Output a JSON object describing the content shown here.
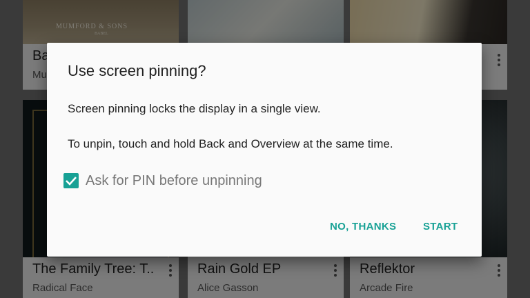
{
  "background": {
    "top_cards": [
      {
        "title": "Ba",
        "subtitle": "Mu",
        "art_text": "MUMFORD & SONS",
        "art_subtext": "BABEL"
      },
      {
        "title": "",
        "subtitle": ""
      },
      {
        "title": "",
        "subtitle": ""
      }
    ],
    "bottom_cards": [
      {
        "title": "The Family Tree: T..",
        "subtitle": "Radical Face"
      },
      {
        "title": "Rain Gold EP",
        "subtitle": "Alice Gasson"
      },
      {
        "title": "Reflektor",
        "subtitle": "Arcade Fire"
      }
    ]
  },
  "dialog": {
    "title": "Use screen pinning?",
    "line1": "Screen pinning locks the display in a single view.",
    "line2": "To unpin, touch and hold Back and Overview at the same time.",
    "checkbox": {
      "label": "Ask for PIN before unpinning",
      "checked": true
    },
    "buttons": {
      "negative": "NO, THANKS",
      "positive": "START"
    }
  },
  "colors": {
    "accent": "#17a195"
  }
}
